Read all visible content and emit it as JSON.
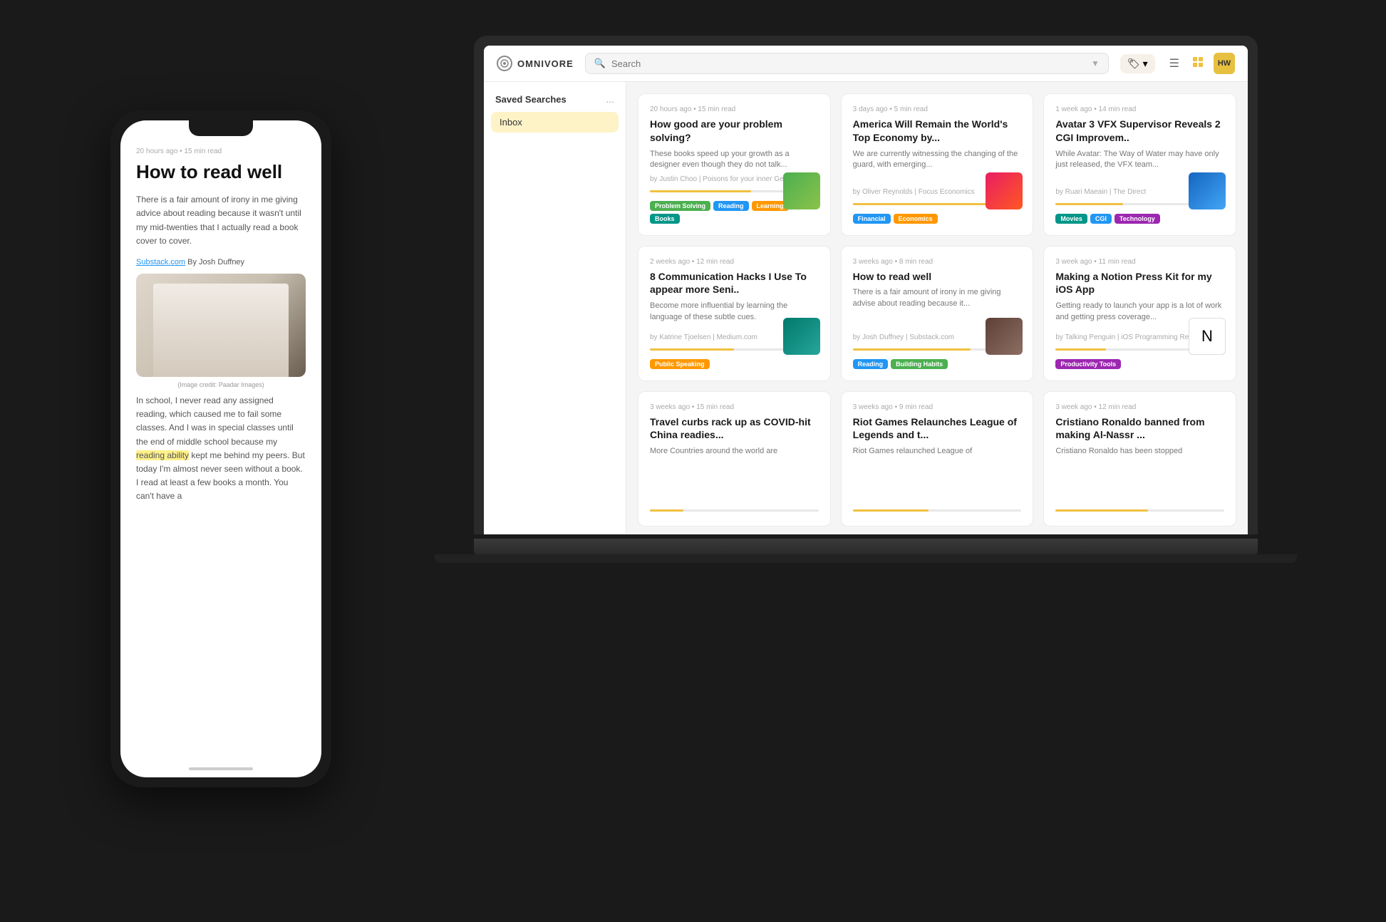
{
  "app": {
    "logo_text": "OMNIVORE",
    "logo_icon": "O"
  },
  "header": {
    "search_placeholder": "Search",
    "filter_icon": "▼",
    "label_icon": "🏷",
    "menu_icon": "☰",
    "grid_icon": "⊞",
    "avatar": "HW",
    "avatar_bg": "#e8c040"
  },
  "sidebar": {
    "section_title": "Saved Searches",
    "more_icon": "...",
    "items": [
      {
        "label": "Inbox",
        "active": true
      }
    ]
  },
  "articles": [
    {
      "meta": "20 hours ago • 15 min read",
      "title": "How good are your problem solving?",
      "excerpt": "These books speed up your growth as a designer even though they do not talk...",
      "source": "by Justin Choo | Poisons for your inner Geek",
      "progress": 60,
      "tags": [
        {
          "label": "Problem Solving",
          "color": "tag-green"
        },
        {
          "label": "Reading",
          "color": "tag-blue"
        },
        {
          "label": "Learning",
          "color": "tag-orange"
        },
        {
          "label": "Books",
          "color": "tag-teal"
        }
      ],
      "thumb": "thumb-green"
    },
    {
      "meta": "3 days ago • 5 min read",
      "title": "America Will Remain the World's Top Economy by...",
      "excerpt": "We are currently witnessing the changing of the guard, with emerging...",
      "source": "by Oliver Reynolds | Focus Economics",
      "progress": 80,
      "tags": [
        {
          "label": "Financial",
          "color": "tag-blue"
        },
        {
          "label": "Economics",
          "color": "tag-orange"
        }
      ],
      "thumb": "thumb-pink"
    },
    {
      "meta": "1 week ago • 14 min read",
      "title": "Avatar 3 VFX Supervisor Reveals 2 CGI Improvem..",
      "excerpt": "While Avatar: The Way of Water may have only just released, the VFX team...",
      "source": "by Ruari Maeain | The Direct",
      "progress": 40,
      "tags": [
        {
          "label": "Movies",
          "color": "tag-teal"
        },
        {
          "label": "CGI",
          "color": "tag-blue"
        },
        {
          "label": "Technology",
          "color": "tag-purple"
        }
      ],
      "thumb": "thumb-blue-avatar"
    },
    {
      "meta": "2 weeks ago • 12 min read",
      "title": "8 Communication Hacks I Use To appear more Seni..",
      "excerpt": "Become more influential by learning the language of these subtle cues.",
      "source": "by Katrine Tjoelsen | Medium.com",
      "progress": 50,
      "tags": [
        {
          "label": "Public Speaking",
          "color": "tag-orange"
        }
      ],
      "thumb": "thumb-teal"
    },
    {
      "meta": "3 weeks ago • 8 min read",
      "title": "How to read well",
      "excerpt": "There is a fair amount of irony in me giving advise about reading because it...",
      "source": "by Josh Duffney | Substack.com",
      "progress": 70,
      "tags": [
        {
          "label": "Reading",
          "color": "tag-blue"
        },
        {
          "label": "Building Habits",
          "color": "tag-green"
        }
      ],
      "thumb": "thumb-book"
    },
    {
      "meta": "3 week ago • 11 min read",
      "title": "Making a Notion Press Kit for my iOS App",
      "excerpt": "Getting ready to launch your app is a lot of work and getting press coverage...",
      "source": "by Talking Penguin | iOS Programming Reddit",
      "progress": 30,
      "tags": [
        {
          "label": "Productivity Tools",
          "color": "tag-purple"
        }
      ],
      "thumb": "thumb-notion"
    },
    {
      "meta": "3 weeks ago • 15 min read",
      "title": "Travel curbs rack up as COVID-hit China readies...",
      "excerpt": "More Countries around the world are",
      "source": "",
      "progress": 20,
      "tags": [],
      "thumb": null
    },
    {
      "meta": "3 weeks ago • 9 min read",
      "title": "Riot Games Relaunches League of Legends and t...",
      "excerpt": "Riot Games relaunched League of",
      "source": "",
      "progress": 45,
      "tags": [],
      "thumb": null
    },
    {
      "meta": "3 week ago • 12 min read",
      "title": "Cristiano Ronaldo banned from making Al-Nassr ...",
      "excerpt": "Cristiano Ronaldo has been stopped",
      "source": "",
      "progress": 55,
      "tags": [],
      "thumb": null
    }
  ],
  "phone": {
    "article_meta": "20 hours ago • 15 min read",
    "article_title": "How to read well",
    "article_body1": "There is a fair amount of irony in me giving advice about reading because it wasn't until my mid-twenties that I actually read a book cover to cover.",
    "source_link": "Substack.com",
    "author": "By Josh Duffney",
    "image_caption": "(Image credit: Paadar Images)",
    "article_body2": "In school, I never read any assigned reading, which caused me to fail some classes. And I was in special classes until the end of middle school because my ",
    "highlighted_text": "reading ability",
    "article_body3": " kept me behind my peers. But today I'm almost never seen without a book. I read at least a few books a month. You can't have a"
  }
}
